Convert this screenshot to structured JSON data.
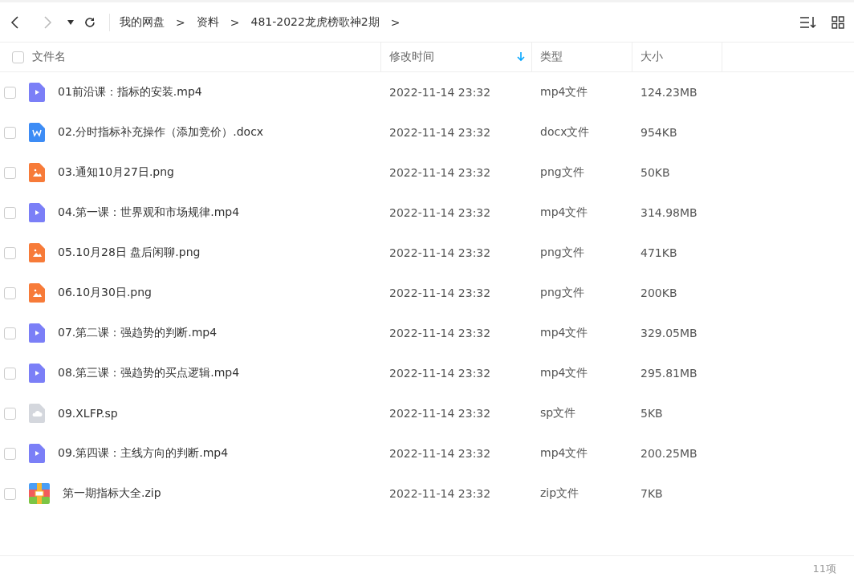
{
  "breadcrumb": [
    {
      "label": "我的网盘"
    },
    {
      "label": "资料"
    },
    {
      "label": "481-2022龙虎榜歌神2期"
    }
  ],
  "breadcrumb_separator": ">",
  "select_all": {
    "checked": false
  },
  "columns": [
    {
      "label": "文件名",
      "sorted": false
    },
    {
      "label": "修改时间",
      "sorted": true
    },
    {
      "label": "类型",
      "sorted": false
    },
    {
      "label": "大小",
      "sorted": false
    }
  ],
  "files": [
    {
      "name": "01前沿课：指标的安装.mp4",
      "kind": "video",
      "modified": "2022-11-14 23:32",
      "type": "mp4文件",
      "size": "124.23MB",
      "checked": false
    },
    {
      "name": "02.分时指标补充操作（添加竞价）.docx",
      "kind": "word",
      "modified": "2022-11-14 23:32",
      "type": "docx文件",
      "size": "954KB",
      "checked": false
    },
    {
      "name": "03.通知10月27日.png",
      "kind": "image",
      "modified": "2022-11-14 23:32",
      "type": "png文件",
      "size": "50KB",
      "checked": false
    },
    {
      "name": "04.第一课：世界观和市场规律.mp4",
      "kind": "video",
      "modified": "2022-11-14 23:32",
      "type": "mp4文件",
      "size": "314.98MB",
      "checked": false
    },
    {
      "name": "05.10月28日 盘后闲聊.png",
      "kind": "image",
      "modified": "2022-11-14 23:32",
      "type": "png文件",
      "size": "471KB",
      "checked": false
    },
    {
      "name": "06.10月30日.png",
      "kind": "image",
      "modified": "2022-11-14 23:32",
      "type": "png文件",
      "size": "200KB",
      "checked": false
    },
    {
      "name": "07.第二课：强趋势的判断.mp4",
      "kind": "video",
      "modified": "2022-11-14 23:32",
      "type": "mp4文件",
      "size": "329.05MB",
      "checked": false
    },
    {
      "name": "08.第三课：强趋势的买点逻辑.mp4",
      "kind": "video",
      "modified": "2022-11-14 23:32",
      "type": "mp4文件",
      "size": "295.81MB",
      "checked": false
    },
    {
      "name": "09.XLFP.sp",
      "kind": "cloud",
      "modified": "2022-11-14 23:32",
      "type": "sp文件",
      "size": "5KB",
      "checked": false
    },
    {
      "name": "09.第四课：主线方向的判断.mp4",
      "kind": "video",
      "modified": "2022-11-14 23:32",
      "type": "mp4文件",
      "size": "200.25MB",
      "checked": false
    },
    {
      "name": "第一期指标大全.zip",
      "kind": "zip",
      "modified": "2022-11-14 23:32",
      "type": "zip文件",
      "size": "7KB",
      "checked": false
    }
  ],
  "status_bar": {
    "count": "11项"
  }
}
